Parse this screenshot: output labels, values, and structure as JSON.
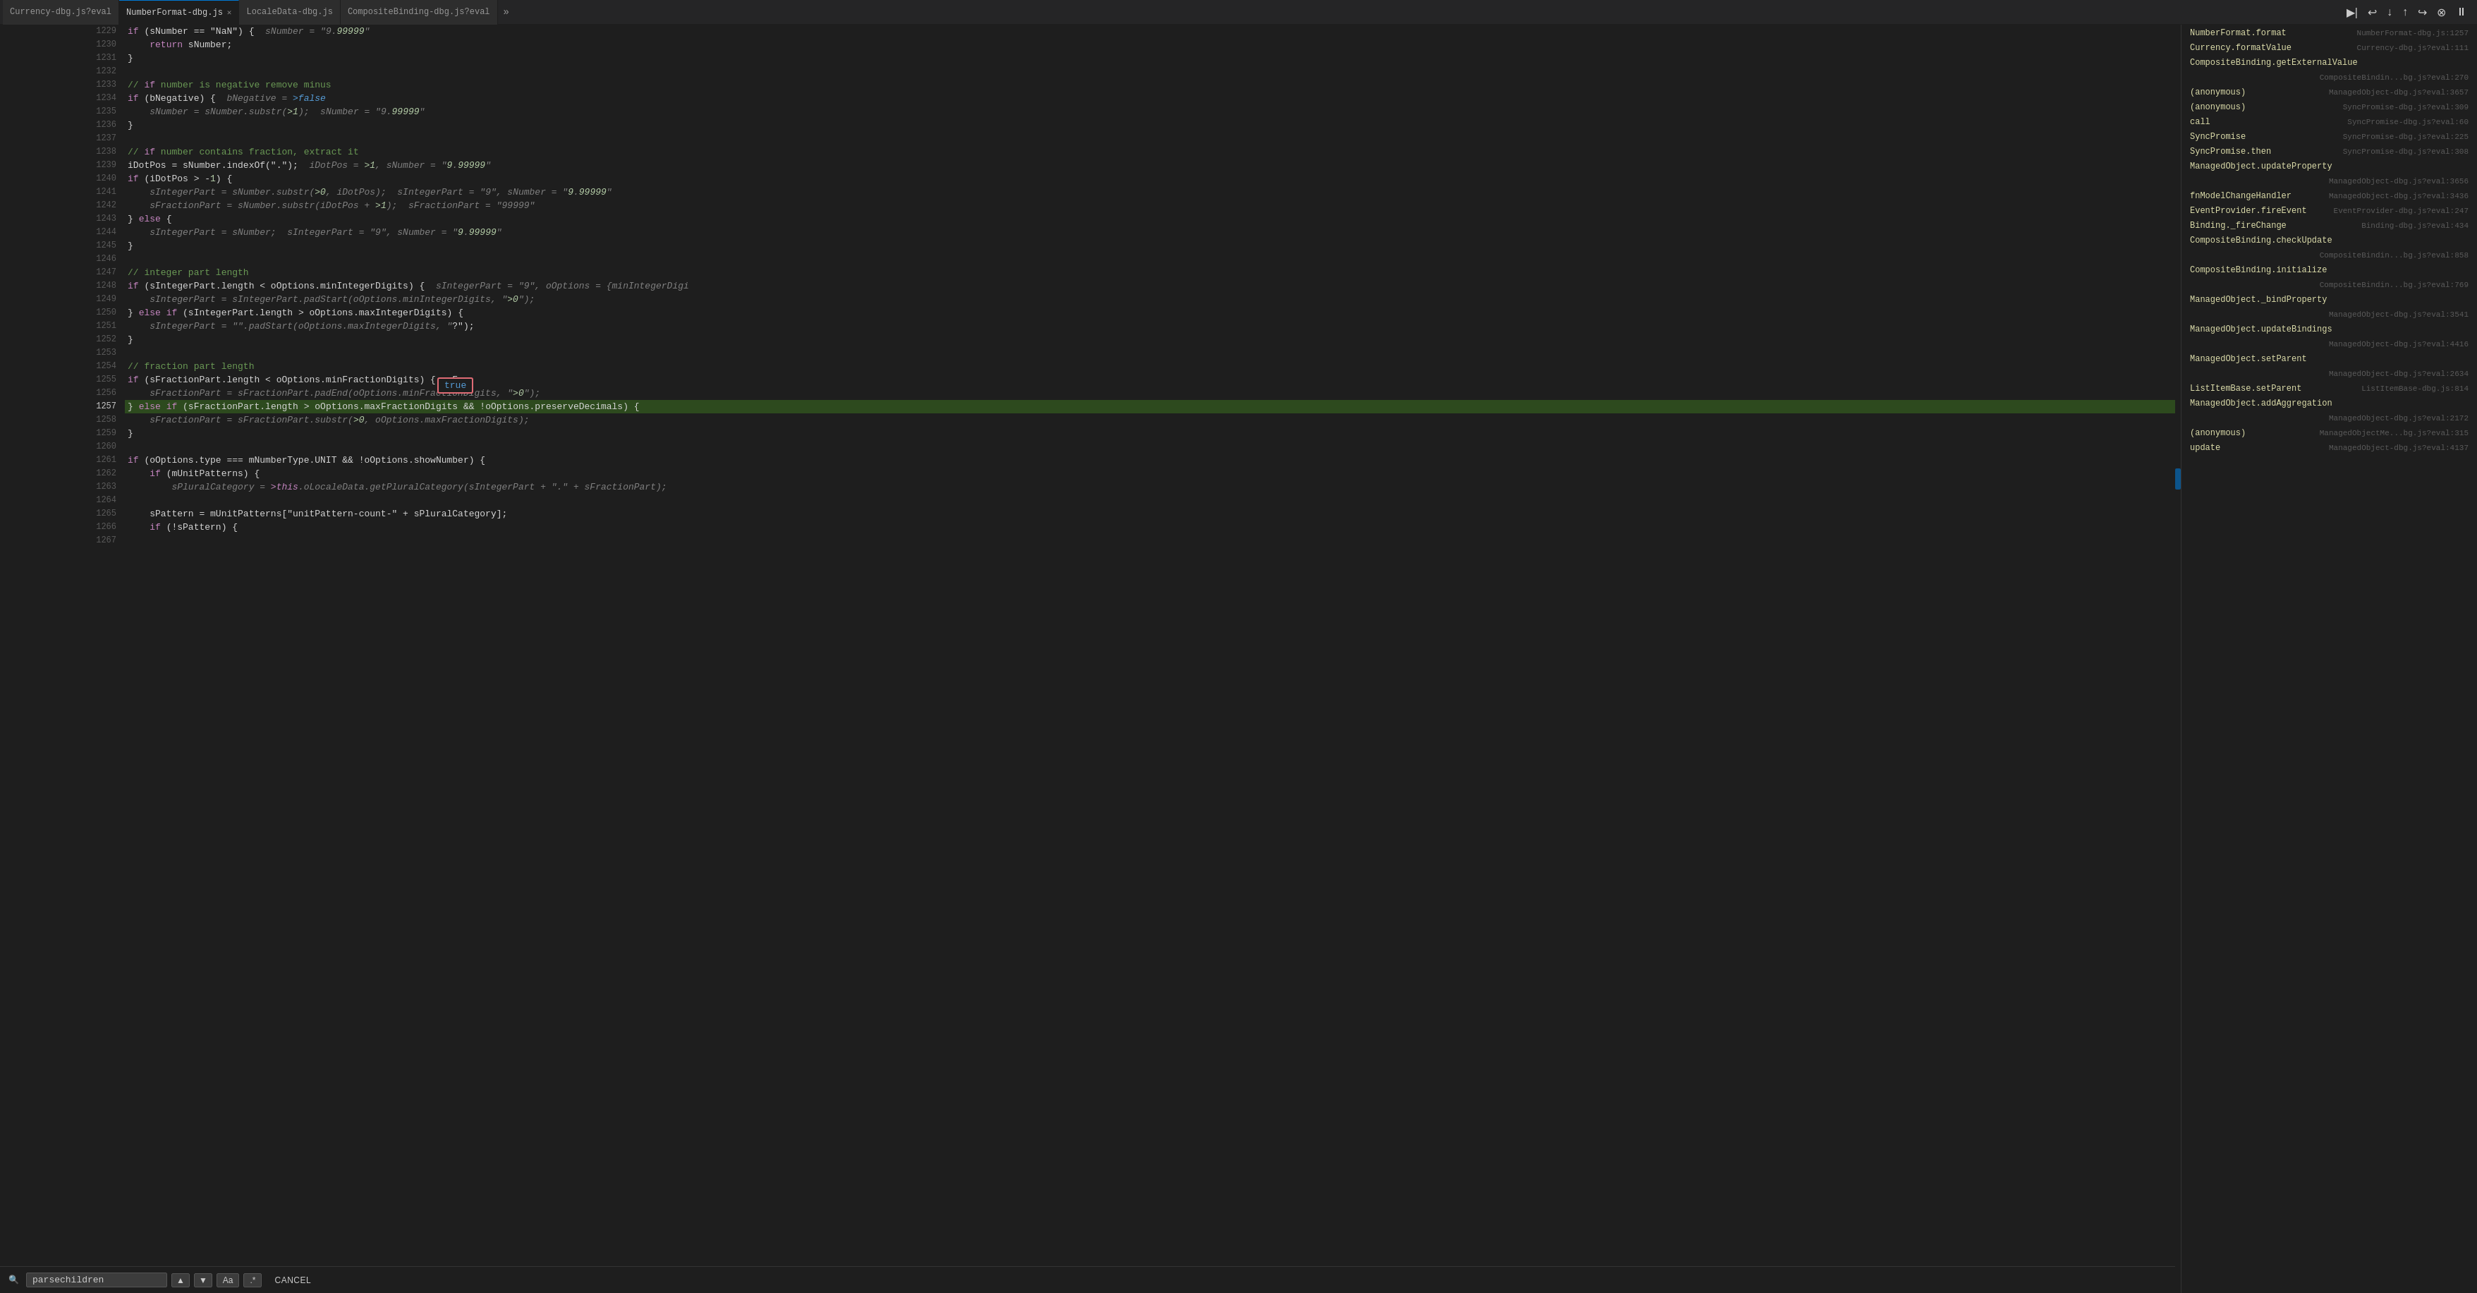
{
  "tabs": [
    {
      "id": "currency",
      "label": "Currency-dbg.js?eval",
      "active": false,
      "closeable": false
    },
    {
      "id": "numberformat",
      "label": "NumberFormat-dbg.js",
      "active": true,
      "closeable": true
    },
    {
      "id": "localedata",
      "label": "LocaleData-dbg.js",
      "active": false,
      "closeable": false
    },
    {
      "id": "compositebinding",
      "label": "CompositeBinding-dbg.js?eval",
      "active": false,
      "closeable": false
    }
  ],
  "tab_overflow_label": "»",
  "debug_buttons": [
    "▶|",
    "↩",
    "↓",
    "↑",
    "↪",
    "⊗",
    "⏸"
  ],
  "lines": [
    {
      "num": "1229",
      "content": "if (sNumber == \"NaN\") {  sNumber = \"9.99999\"",
      "highlight": false
    },
    {
      "num": "1230",
      "content": "    return sNumber;",
      "highlight": false
    },
    {
      "num": "1231",
      "content": "}",
      "highlight": false
    },
    {
      "num": "1232",
      "content": "",
      "highlight": false
    },
    {
      "num": "1233",
      "content": "// if number is negative remove minus",
      "highlight": false
    },
    {
      "num": "1234",
      "content": "if (bNegative) {  bNegative = false",
      "highlight": false
    },
    {
      "num": "1235",
      "content": "    sNumber = sNumber.substr(1);  sNumber = \"9.99999\"",
      "highlight": false
    },
    {
      "num": "1236",
      "content": "}",
      "highlight": false
    },
    {
      "num": "1237",
      "content": "",
      "highlight": false
    },
    {
      "num": "1238",
      "content": "// if number contains fraction, extract it",
      "highlight": false
    },
    {
      "num": "1239",
      "content": "iDotPos = sNumber.indexOf(\".\");  iDotPos = 1, sNumber = \"9.99999\"",
      "highlight": false
    },
    {
      "num": "1240",
      "content": "if (iDotPos > -1) {",
      "highlight": false
    },
    {
      "num": "1241",
      "content": "    sIntegerPart = sNumber.substr(0, iDotPos);  sIntegerPart = \"9\", sNumber = \"9.99999\"",
      "highlight": false
    },
    {
      "num": "1242",
      "content": "    sFractionPart = sNumber.substr(iDotPos + 1);  sFractionPart = \"99999\"",
      "highlight": false
    },
    {
      "num": "1243",
      "content": "} else {",
      "highlight": false
    },
    {
      "num": "1244",
      "content": "    sIntegerPart = sNumber;  sIntegerPart = \"9\", sNumber = \"9.99999\"",
      "highlight": false
    },
    {
      "num": "1245",
      "content": "}",
      "highlight": false
    },
    {
      "num": "1246",
      "content": "",
      "highlight": false
    },
    {
      "num": "1247",
      "content": "// integer part length",
      "highlight": false
    },
    {
      "num": "1248",
      "content": "if (sIntegerPart.length < oOptions.minIntegerDigits) {  sIntegerPart = \"9\", oOptions = {minIntegerDigi",
      "highlight": false
    },
    {
      "num": "1249",
      "content": "    sIntegerPart = sIntegerPart.padStart(oOptions.minIntegerDigits, \"0\");",
      "highlight": false
    },
    {
      "num": "1250",
      "content": "} else if (sIntegerPart.length > oOptions.maxIntegerDigits) {",
      "highlight": false
    },
    {
      "num": "1251",
      "content": "    sIntegerPart = \"\".padStart(oOptions.maxIntegerDigits, \"?\");",
      "highlight": false
    },
    {
      "num": "1252",
      "content": "}",
      "highlight": false
    },
    {
      "num": "1253",
      "content": "",
      "highlight": false
    },
    {
      "num": "1254",
      "content": "// fraction part length",
      "highlight": false
    },
    {
      "num": "1255",
      "content": "if (sFractionPart.length < oOptions.minFractionDigits) {  sFra",
      "highlight": false
    },
    {
      "num": "1256",
      "content": "    sFractionPart = sFractionPart.padEnd(oOptions.minFractionDigits, \"0\");",
      "highlight": false
    },
    {
      "num": "1257",
      "content": "} else if (sFractionPart.length > oOptions.maxFractionDigits && !oOptions.preserveDecimals) {",
      "highlight": true
    },
    {
      "num": "1258",
      "content": "    sFractionPart = sFractionPart.substr(0, oOptions.maxFractionDigits);",
      "highlight": false
    },
    {
      "num": "1259",
      "content": "}",
      "highlight": false
    },
    {
      "num": "1260",
      "content": "",
      "highlight": false
    },
    {
      "num": "1261",
      "content": "if (oOptions.type === mNumberType.UNIT && !oOptions.showNumber) {",
      "highlight": false
    },
    {
      "num": "1262",
      "content": "    if (mUnitPatterns) {",
      "highlight": false
    },
    {
      "num": "1263",
      "content": "        sPluralCategory = this.oLocaleData.getPluralCategory(sIntegerPart + \".\" + sFractionPart);",
      "highlight": false
    },
    {
      "num": "1264",
      "content": "",
      "highlight": false
    },
    {
      "num": "1265",
      "content": "    sPattern = mUnitPatterns[\"unitPattern-count-\" + sPluralCategory];",
      "highlight": false
    },
    {
      "num": "1266",
      "content": "    if (!sPattern) {",
      "highlight": false
    },
    {
      "num": "1267",
      "content": "",
      "highlight": false
    }
  ],
  "tooltip": {
    "value": "true",
    "visible": true
  },
  "search": {
    "placeholder": "parsechildren",
    "value": "parsechildren",
    "match_case_label": "Aa",
    "regex_label": ".*",
    "cancel_label": "CANCEL",
    "nav_up": "▲",
    "nav_down": "▼"
  },
  "callstack": [
    {
      "name": "NumberFormat.format",
      "file": "NumberFormat-dbg.js:1257"
    },
    {
      "name": "Currency.formatValue",
      "file": "Currency-dbg.js?eval:111"
    },
    {
      "name": "CompositeBinding.getExternalValue",
      "file": ""
    },
    {
      "name": "",
      "file": "CompositeBindin...bg.js?eval:270"
    },
    {
      "name": "(anonymous)",
      "file": "ManagedObject-dbg.js?eval:3657"
    },
    {
      "name": "(anonymous)",
      "file": "SyncPromise-dbg.js?eval:309"
    },
    {
      "name": "call",
      "file": "SyncPromise-dbg.js?eval:60"
    },
    {
      "name": "SyncPromise",
      "file": "SyncPromise-dbg.js?eval:225"
    },
    {
      "name": "SyncPromise.then",
      "file": "SyncPromise-dbg.js?eval:308"
    },
    {
      "name": "ManagedObject.updateProperty",
      "file": ""
    },
    {
      "name": "",
      "file": "ManagedObject-dbg.js?eval:3656"
    },
    {
      "name": "fnModelChangeHandler",
      "file": "ManagedObject-dbg.js?eval:3436"
    },
    {
      "name": "EventProvider.fireEvent",
      "file": "EventProvider-dbg.js?eval:247"
    },
    {
      "name": "Binding._fireChange",
      "file": "Binding-dbg.js?eval:434"
    },
    {
      "name": "CompositeBinding.checkUpdate",
      "file": ""
    },
    {
      "name": "",
      "file": "CompositeBindin...bg.js?eval:858"
    },
    {
      "name": "CompositeBinding.initialize",
      "file": ""
    },
    {
      "name": "",
      "file": "CompositeBindin...bg.js?eval:769"
    },
    {
      "name": "ManagedObject._bindProperty",
      "file": ""
    },
    {
      "name": "",
      "file": "ManagedObject-dbg.js?eval:3541"
    },
    {
      "name": "ManagedObject.updateBindings",
      "file": ""
    },
    {
      "name": "",
      "file": "ManagedObject-dbg.js?eval:4416"
    },
    {
      "name": "ManagedObject.setParent",
      "file": ""
    },
    {
      "name": "",
      "file": "ManagedObject-dbg.js?eval:2634"
    },
    {
      "name": "ListItemBase.setParent",
      "file": "ListItemBase-dbg.js:814"
    },
    {
      "name": "ManagedObject.addAggregation",
      "file": ""
    },
    {
      "name": "",
      "file": "ManagedObject-dbg.js?eval:2172"
    },
    {
      "name": "(anonymous)",
      "file": "ManagedObjectMe...bg.js?eval:315"
    },
    {
      "name": "update",
      "file": "ManagedObject-dbg.js?eval:4137"
    }
  ],
  "colors": {
    "accent_blue": "#0078d4",
    "highlight_green_bg": "#2d4a1e",
    "tooltip_border": "#e06c75",
    "tab_active_border": "#0078d4"
  }
}
